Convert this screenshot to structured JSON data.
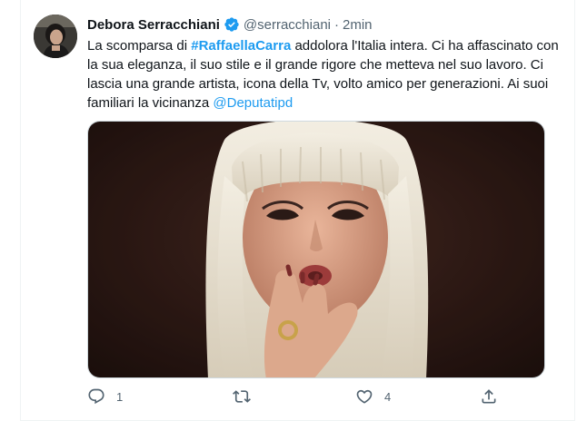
{
  "tweet": {
    "author_name": "Debora Serracchiani",
    "author_handle": "@serracchiani",
    "separator": "·",
    "timestamp": "2min",
    "text_before": "La scomparsa di ",
    "hashtag": "#RaffaellaCarra",
    "text_middle": " addolora l'Italia intera. Ci ha affascinato con la sua eleganza, il suo stile e il grande rigore che metteva nel suo lavoro. Ci lascia una grande artista, icona della Tv, volto amico per generazioni. Ai suoi familiari la vicinanza ",
    "mention": "@Deputatipd"
  },
  "actions": {
    "reply_count": "1",
    "retweet_count": "",
    "like_count": "4",
    "share_count": ""
  },
  "icons": {
    "verified": "verified-badge-icon",
    "reply": "reply-icon",
    "retweet": "retweet-icon",
    "like": "heart-icon",
    "share": "share-icon"
  },
  "colors": {
    "link": "#1d9bf0",
    "secondary_text": "#536471",
    "primary_text": "#0f1419"
  }
}
